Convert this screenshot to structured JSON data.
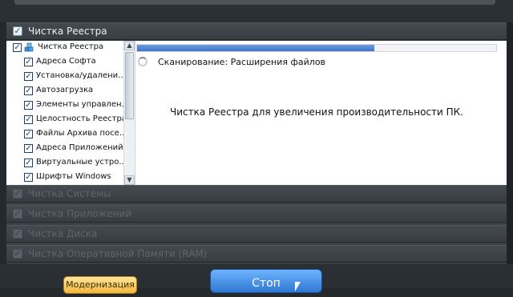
{
  "sections": {
    "registry_header": "Чистка Реестра",
    "dim_headers": [
      "Чистка Системы",
      "Чистка Приложений",
      "Чистка Диска",
      "Чистка Оперативной Памяти (RAM)"
    ]
  },
  "tree": {
    "root_label": "Чистка Реестра",
    "items": [
      "Адреса Софта",
      "Установка/удалени...",
      "Автозагрузка",
      "Элементы управлен...",
      "Целостность Реестра",
      "Файлы Архива посе...",
      "Адреса Приложений",
      "Виртуальные устро...",
      "Шрифты Windows"
    ]
  },
  "scan": {
    "progress_fraction": 0.66,
    "status_text": "Сканирование: Расширения файлов",
    "message": "Чистка Реестра для увеличения производительности ПК."
  },
  "footer": {
    "modernize_label": "Модернизация",
    "stop_label": "Стоп"
  },
  "colors": {
    "accent_blue": "#3e74c8",
    "stop_button": "#2f78d3",
    "modernize_button": "#f3b83a"
  }
}
